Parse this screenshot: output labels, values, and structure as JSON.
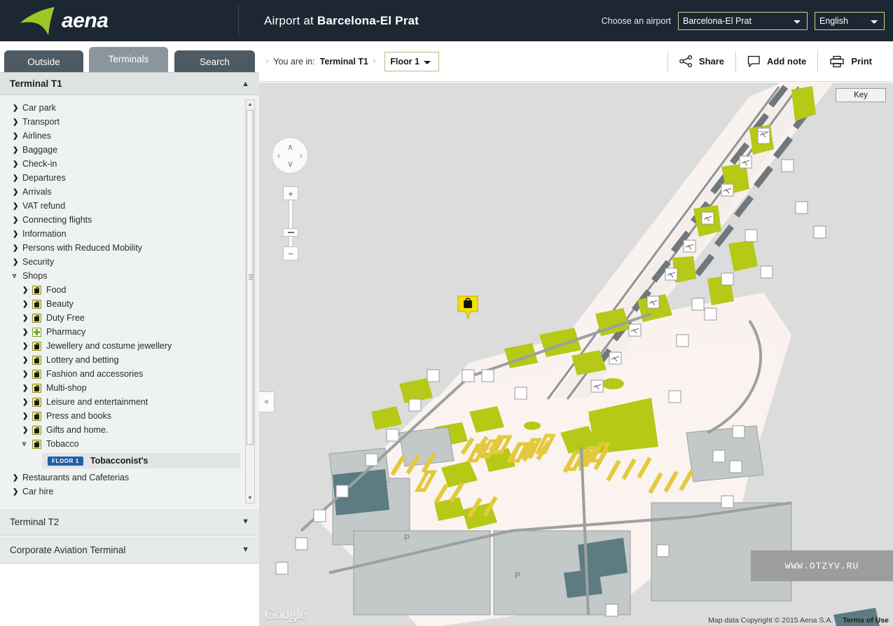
{
  "header": {
    "logo_text": "aena",
    "logo_icon": "aena-swoosh-logo",
    "title_prefix": "Airport at ",
    "title_airport": "Barcelona-El Prat",
    "airport_label": "Choose an airport",
    "airport_value": "Barcelona-El Prat",
    "airport_options": [
      "Barcelona-El Prat"
    ],
    "language_value": "English",
    "language_options": [
      "English"
    ]
  },
  "tabs": [
    {
      "label": "Outside",
      "active": false
    },
    {
      "label": "Terminals",
      "active": true
    },
    {
      "label": "Search",
      "active": false
    }
  ],
  "sidebar": {
    "panel_title": "Terminal T1",
    "panel_chevron": "▲",
    "categories": [
      {
        "label": "Car park"
      },
      {
        "label": "Transport"
      },
      {
        "label": "Airlines"
      },
      {
        "label": "Baggage"
      },
      {
        "label": "Check-in"
      },
      {
        "label": "Departures"
      },
      {
        "label": "Arrivals"
      },
      {
        "label": "VAT refund"
      },
      {
        "label": "Connecting flights"
      },
      {
        "label": "Information"
      },
      {
        "label": "Persons with Reduced Mobility"
      },
      {
        "label": "Security"
      },
      {
        "label": "Shops"
      }
    ],
    "shop_items": [
      {
        "label": "Food",
        "icon": "shopping-bag-icon"
      },
      {
        "label": "Beauty",
        "icon": "shopping-bag-icon"
      },
      {
        "label": "Duty Free",
        "icon": "shopping-bag-icon"
      },
      {
        "label": "Pharmacy",
        "icon": "green-cross-icon"
      },
      {
        "label": "Jewellery and costume jewellery",
        "icon": "shopping-bag-icon"
      },
      {
        "label": "Lottery and betting",
        "icon": "shopping-bag-icon"
      },
      {
        "label": "Fashion and accessories",
        "icon": "shopping-bag-icon"
      },
      {
        "label": "Multi-shop",
        "icon": "shopping-bag-icon"
      },
      {
        "label": "Leisure and entertainment",
        "icon": "shopping-bag-icon"
      },
      {
        "label": "Press and books",
        "icon": "shopping-bag-icon"
      },
      {
        "label": "Gifts and home.",
        "icon": "shopping-bag-icon"
      },
      {
        "label": "Tobacco",
        "icon": "shopping-bag-icon"
      }
    ],
    "selected_poi": {
      "floor_badge": "FLOOR 1",
      "name": "Tobacconist's"
    },
    "categories_after": [
      {
        "label": "Restaurants and Cafeterias"
      },
      {
        "label": "Car hire"
      }
    ],
    "accordions": [
      {
        "label": "Terminal T2",
        "chevron": "▼"
      },
      {
        "label": "Corporate Aviation Terminal",
        "chevron": "▼"
      }
    ],
    "arrow_collapsed": "❯",
    "arrow_expanded": "▿"
  },
  "map_toolbar": {
    "bc_arrow": "›",
    "you_are_in": "You are in:",
    "terminal": "Terminal T1",
    "floor_value": "Floor 1",
    "floor_options": [
      "Floor 1"
    ],
    "actions": [
      {
        "label": "Share",
        "icon": "share-nodes-icon"
      },
      {
        "label": "Add note",
        "icon": "speech-bubble-icon"
      },
      {
        "label": "Print",
        "icon": "printer-icon"
      }
    ]
  },
  "map": {
    "key_button": "Key",
    "collapse_handle": "«",
    "pan_up": "∧",
    "pan_down": "∨",
    "pan_left": "‹",
    "pan_right": "›",
    "zoom_in": "+",
    "zoom_out": "−",
    "google_logo": "Google",
    "watermark": "WWW.OTZYV.RU",
    "copyright": "Map data Copyright © 2015 Aena S.A.",
    "terms": "Terms of Use",
    "parking_labels": [
      "P",
      "P"
    ],
    "marker": {
      "icon": "shopping-bag-map-marker",
      "color": "#f5e000"
    },
    "colors": {
      "map_background": "#dcdcdc",
      "terminal_floor": "#faf1ee",
      "vegetation": "#b5c916",
      "building_gray": "#c6cbcb",
      "accent_header": "#1c2733"
    }
  }
}
